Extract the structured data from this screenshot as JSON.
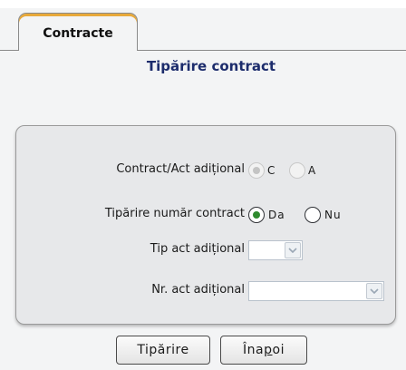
{
  "tab": {
    "label": "Contracte"
  },
  "page": {
    "title": "Tipărire contract"
  },
  "form": {
    "contract_type": {
      "label": "Contract/Act adițional",
      "options": [
        {
          "label": "C",
          "selected": true,
          "disabled": true
        },
        {
          "label": "A",
          "selected": false,
          "disabled": true
        }
      ]
    },
    "print_number": {
      "label": "Tipărire număr contract",
      "options": [
        {
          "label": "Da",
          "selected": true,
          "disabled": false
        },
        {
          "label": "Nu",
          "selected": false,
          "disabled": false
        }
      ]
    },
    "act_type": {
      "label": "Tip act adițional",
      "value": ""
    },
    "act_number": {
      "label": "Nr. act adițional",
      "value": ""
    }
  },
  "buttons": {
    "print": "Tipărire",
    "back": {
      "before": "Îna",
      "mnemonic": "p",
      "after": "oi"
    }
  },
  "colors": {
    "tab_accent": "#e8a93a",
    "title": "#1c2c6c",
    "radio_selected": "#2e8a2e"
  },
  "icons": [
    "chevron-down-icon"
  ]
}
